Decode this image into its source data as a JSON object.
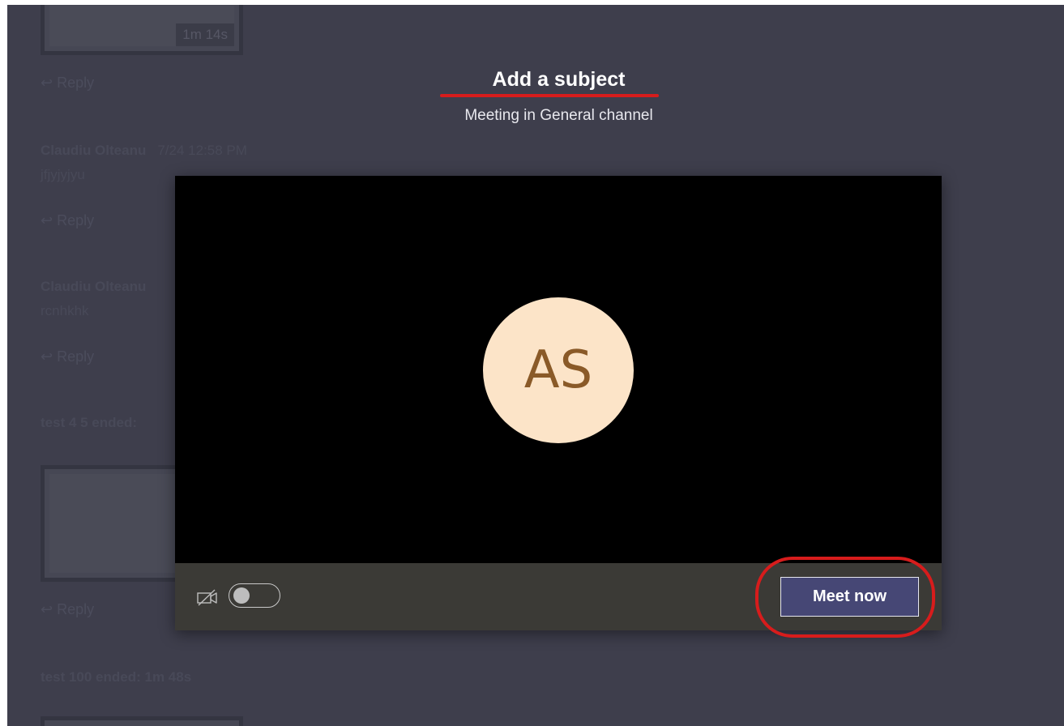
{
  "header": {
    "title": "Add a subject",
    "subtitle": "Meeting in General channel"
  },
  "preview": {
    "avatar_initials": "AS",
    "avatar_bg": "#fce4c8",
    "avatar_fg": "#8a5a28"
  },
  "controls": {
    "camera_icon": "camera-off-icon",
    "camera_toggle_on": false,
    "meet_now_label": "Meet now"
  },
  "background": {
    "duration_1": "1m 14s",
    "reply_label": "Reply",
    "message_1": {
      "author": "Claudiu Olteanu",
      "time": "7/24 12:58 PM",
      "text": "jfjyjyjyu"
    },
    "message_2": {
      "author": "Claudiu Olteanu",
      "text": "rcnhkhk"
    },
    "event_1": "test 4 5 ended:",
    "event_2": "test 100 ended: 1m 48s"
  },
  "colors": {
    "annotation_red": "#d71c1c",
    "button_purple": "#464775"
  }
}
